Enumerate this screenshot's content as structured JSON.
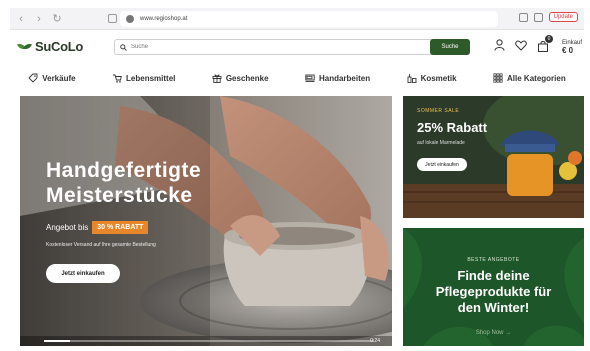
{
  "browser": {
    "url": "www.regioshop.at",
    "update_label": "Update"
  },
  "header": {
    "logo_text": "SuCoLo",
    "search_placeholder": "Suche",
    "search_button": "Suche",
    "cart_count": "0",
    "cart_label": "Einkauf",
    "cart_total": "€ 0"
  },
  "categories": [
    {
      "label": "Verkäufe",
      "icon": "tag-icon"
    },
    {
      "label": "Lebensmittel",
      "icon": "grocery-icon"
    },
    {
      "label": "Geschenke",
      "icon": "gift-icon"
    },
    {
      "label": "Handarbeiten",
      "icon": "sewing-machine-icon"
    },
    {
      "label": "Kosmetik",
      "icon": "cosmetics-icon"
    },
    {
      "label": "Alle Kategorien",
      "icon": "grid-icon"
    }
  ],
  "hero": {
    "title_line1": "Handgefertigte",
    "title_line2": "Meisterstücke",
    "offer_prefix": "Angebot bis",
    "offer_badge": "30 % RABATT",
    "shipping_note": "Kostenloser Versand auf Ihre gesamte Bestellung",
    "cta": "Jetzt einkaufen",
    "video_time": "0:24",
    "video_progress": 0.08
  },
  "promo_sale": {
    "kicker": "SOMMER SALE",
    "headline": "25% Rabatt",
    "subline": "auf lokale Marmelade",
    "cta": "Jetzt einkaufen"
  },
  "promo_best": {
    "kicker": "BESTE ANGEBOTE",
    "headline_line1": "Finde deine",
    "headline_line2": "Pflegeprodukte für",
    "headline_line3": "den Winter!",
    "link": "Shop Now →"
  },
  "colors": {
    "brand_green": "#2e5a2a",
    "offer_orange": "#e8862a",
    "promo_dark": "#2f3a2c",
    "promo_green": "#1f5a2a"
  }
}
